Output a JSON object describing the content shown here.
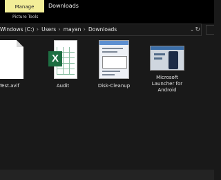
{
  "ribbon": {
    "contextual_tab": "Manage",
    "contextual_group": "Picture Tools",
    "tabs": [
      "Downloads"
    ]
  },
  "address": {
    "crumbs": [
      "Windows (C:)",
      "Users",
      "mayan",
      "Downloads"
    ]
  },
  "files": [
    {
      "name": "A Test.avif",
      "icon": "generic-file-icon"
    },
    {
      "name": "Audit",
      "icon": "excel-file-icon"
    },
    {
      "name": "Disk-Cleanup",
      "icon": "image-thumbnail"
    },
    {
      "name": "Microsoft Launcher for Android",
      "icon": "image-thumbnail"
    }
  ],
  "colors": {
    "contextual_tab_bg": "#f3ee98",
    "window_bg": "#191919",
    "excel_green": "#1d6f42"
  }
}
